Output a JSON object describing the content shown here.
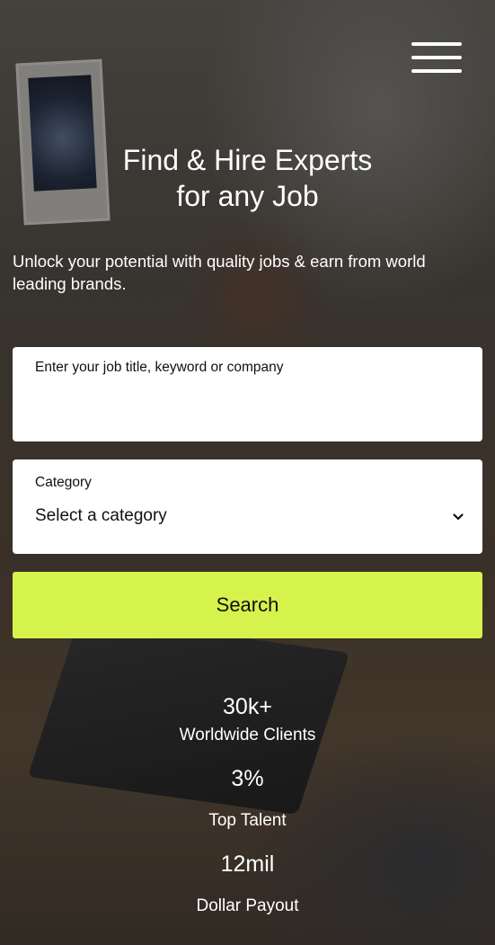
{
  "hero": {
    "title_line1": "Find & Hire Experts",
    "title_line2": "for any Job",
    "subtitle": "Unlock your potential with quality jobs & earn from world leading brands."
  },
  "search_form": {
    "keyword_placeholder": "Enter your job title, keyword or company",
    "category_label": "Category",
    "category_selected": "Select a category",
    "search_label": "Search"
  },
  "stats": [
    {
      "value": "30k+",
      "label": "Worldwide Clients"
    },
    {
      "value": "3%",
      "label": "Top Talent"
    },
    {
      "value": "12mil",
      "label": "Dollar Payout"
    }
  ],
  "colors": {
    "accent": "#d6f24c",
    "text_light": "#ffffff",
    "field_bg": "#ffffff"
  },
  "icons": {
    "menu": "hamburger-menu-icon",
    "dropdown": "chevron-down-icon"
  }
}
